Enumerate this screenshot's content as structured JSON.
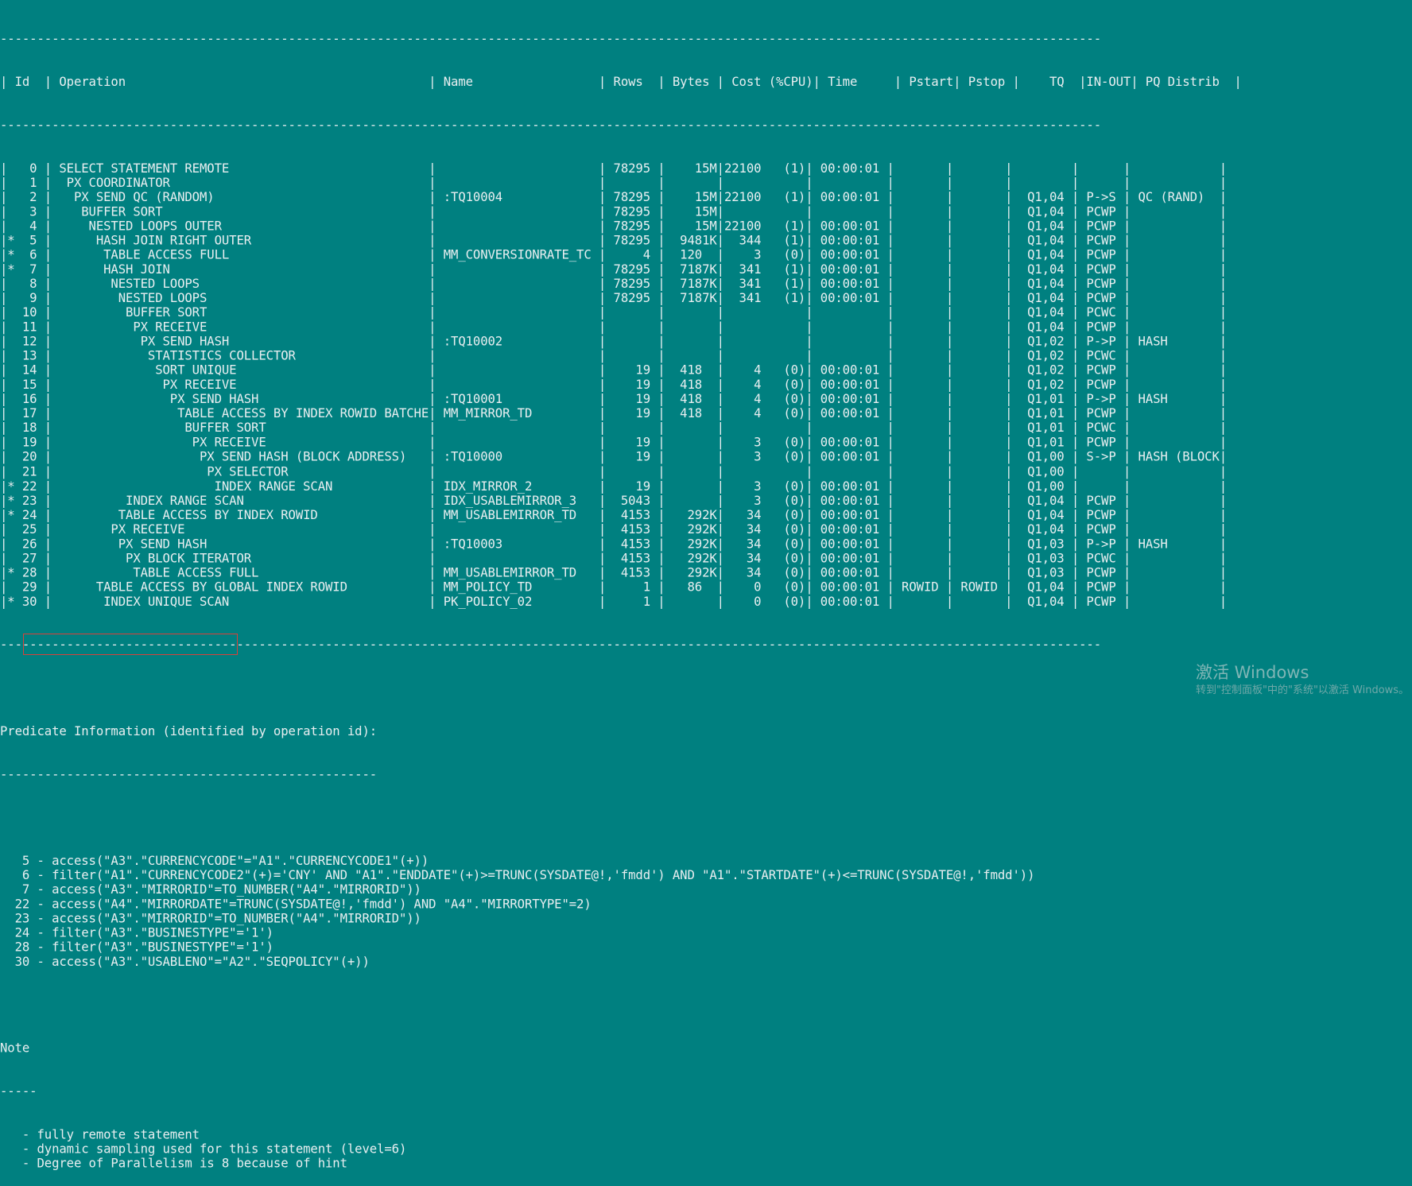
{
  "plan": {
    "dash_line": "-----------------------------------------------------------------------------------------------------------------------------------------------------",
    "columns": [
      "Id",
      "Operation",
      "Name",
      "Rows",
      "Bytes",
      "Cost (%CPU)",
      "Time",
      "Pstart",
      "Pstop",
      "TQ",
      "IN-OUT",
      "PQ Distrib"
    ],
    "rows": [
      {
        "star": "",
        "id": "0",
        "depth": 0,
        "op": "SELECT STATEMENT REMOTE",
        "name": "",
        "rows": "78295",
        "bytes": "15M",
        "cost": "22100",
        "cpu": "(1)",
        "time": "00:00:01",
        "pstart": "",
        "pstop": "",
        "tq": "",
        "inout": "",
        "pq": ""
      },
      {
        "star": "",
        "id": "1",
        "depth": 1,
        "op": "PX COORDINATOR",
        "name": "",
        "rows": "",
        "bytes": "",
        "cost": "",
        "cpu": "",
        "time": "",
        "pstart": "",
        "pstop": "",
        "tq": "",
        "inout": "",
        "pq": ""
      },
      {
        "star": "",
        "id": "2",
        "depth": 2,
        "op": "PX SEND QC (RANDOM)",
        "name": ":TQ10004",
        "rows": "78295",
        "bytes": "15M",
        "cost": "22100",
        "cpu": "(1)",
        "time": "00:00:01",
        "pstart": "",
        "pstop": "",
        "tq": "Q1,04",
        "inout": "P->S",
        "pq": "QC (RAND)"
      },
      {
        "star": "",
        "id": "3",
        "depth": 3,
        "op": "BUFFER SORT",
        "name": "",
        "rows": "78295",
        "bytes": "15M",
        "cost": "",
        "cpu": "",
        "time": "",
        "pstart": "",
        "pstop": "",
        "tq": "Q1,04",
        "inout": "PCWP",
        "pq": ""
      },
      {
        "star": "",
        "id": "4",
        "depth": 4,
        "op": "NESTED LOOPS OUTER",
        "name": "",
        "rows": "78295",
        "bytes": "15M",
        "cost": "22100",
        "cpu": "(1)",
        "time": "00:00:01",
        "pstart": "",
        "pstop": "",
        "tq": "Q1,04",
        "inout": "PCWP",
        "pq": ""
      },
      {
        "star": "*",
        "id": "5",
        "depth": 5,
        "op": "HASH JOIN RIGHT OUTER",
        "name": "",
        "rows": "78295",
        "bytes": "9481K",
        "cost": "344",
        "cpu": "(1)",
        "time": "00:00:01",
        "pstart": "",
        "pstop": "",
        "tq": "Q1,04",
        "inout": "PCWP",
        "pq": ""
      },
      {
        "star": "*",
        "id": "6",
        "depth": 6,
        "op": "TABLE ACCESS FULL",
        "name": "MM_CONVERSIONRATE_TC",
        "rows": "4",
        "bytes": "120",
        "cost": "3",
        "cpu": "(0)",
        "time": "00:00:01",
        "pstart": "",
        "pstop": "",
        "tq": "Q1,04",
        "inout": "PCWP",
        "pq": ""
      },
      {
        "star": "*",
        "id": "7",
        "depth": 6,
        "op": "HASH JOIN",
        "name": "",
        "rows": "78295",
        "bytes": "7187K",
        "cost": "341",
        "cpu": "(1)",
        "time": "00:00:01",
        "pstart": "",
        "pstop": "",
        "tq": "Q1,04",
        "inout": "PCWP",
        "pq": ""
      },
      {
        "star": "",
        "id": "8",
        "depth": 7,
        "op": "NESTED LOOPS",
        "name": "",
        "rows": "78295",
        "bytes": "7187K",
        "cost": "341",
        "cpu": "(1)",
        "time": "00:00:01",
        "pstart": "",
        "pstop": "",
        "tq": "Q1,04",
        "inout": "PCWP",
        "pq": ""
      },
      {
        "star": "",
        "id": "9",
        "depth": 8,
        "op": "NESTED LOOPS",
        "name": "",
        "rows": "78295",
        "bytes": "7187K",
        "cost": "341",
        "cpu": "(1)",
        "time": "00:00:01",
        "pstart": "",
        "pstop": "",
        "tq": "Q1,04",
        "inout": "PCWP",
        "pq": ""
      },
      {
        "star": "",
        "id": "10",
        "depth": 9,
        "op": "BUFFER SORT",
        "name": "",
        "rows": "",
        "bytes": "",
        "cost": "",
        "cpu": "",
        "time": "",
        "pstart": "",
        "pstop": "",
        "tq": "Q1,04",
        "inout": "PCWC",
        "pq": ""
      },
      {
        "star": "",
        "id": "11",
        "depth": 10,
        "op": "PX RECEIVE",
        "name": "",
        "rows": "",
        "bytes": "",
        "cost": "",
        "cpu": "",
        "time": "",
        "pstart": "",
        "pstop": "",
        "tq": "Q1,04",
        "inout": "PCWP",
        "pq": ""
      },
      {
        "star": "",
        "id": "12",
        "depth": 11,
        "op": "PX SEND HASH",
        "name": ":TQ10002",
        "rows": "",
        "bytes": "",
        "cost": "",
        "cpu": "",
        "time": "",
        "pstart": "",
        "pstop": "",
        "tq": "Q1,02",
        "inout": "P->P",
        "pq": "HASH"
      },
      {
        "star": "",
        "id": "13",
        "depth": 12,
        "op": "STATISTICS COLLECTOR",
        "name": "",
        "rows": "",
        "bytes": "",
        "cost": "",
        "cpu": "",
        "time": "",
        "pstart": "",
        "pstop": "",
        "tq": "Q1,02",
        "inout": "PCWC",
        "pq": ""
      },
      {
        "star": "",
        "id": "14",
        "depth": 13,
        "op": "SORT UNIQUE",
        "name": "",
        "rows": "19",
        "bytes": "418",
        "cost": "4",
        "cpu": "(0)",
        "time": "00:00:01",
        "pstart": "",
        "pstop": "",
        "tq": "Q1,02",
        "inout": "PCWP",
        "pq": ""
      },
      {
        "star": "",
        "id": "15",
        "depth": 14,
        "op": "PX RECEIVE",
        "name": "",
        "rows": "19",
        "bytes": "418",
        "cost": "4",
        "cpu": "(0)",
        "time": "00:00:01",
        "pstart": "",
        "pstop": "",
        "tq": "Q1,02",
        "inout": "PCWP",
        "pq": ""
      },
      {
        "star": "",
        "id": "16",
        "depth": 15,
        "op": "PX SEND HASH",
        "name": ":TQ10001",
        "rows": "19",
        "bytes": "418",
        "cost": "4",
        "cpu": "(0)",
        "time": "00:00:01",
        "pstart": "",
        "pstop": "",
        "tq": "Q1,01",
        "inout": "P->P",
        "pq": "HASH"
      },
      {
        "star": "",
        "id": "17",
        "depth": 16,
        "op": "TABLE ACCESS BY INDEX ROWID BATCHED",
        "name": "MM_MIRROR_TD",
        "rows": "19",
        "bytes": "418",
        "cost": "4",
        "cpu": "(0)",
        "time": "00:00:01",
        "pstart": "",
        "pstop": "",
        "tq": "Q1,01",
        "inout": "PCWP",
        "pq": ""
      },
      {
        "star": "",
        "id": "18",
        "depth": 17,
        "op": "BUFFER SORT",
        "name": "",
        "rows": "",
        "bytes": "",
        "cost": "",
        "cpu": "",
        "time": "",
        "pstart": "",
        "pstop": "",
        "tq": "Q1,01",
        "inout": "PCWC",
        "pq": ""
      },
      {
        "star": "",
        "id": "19",
        "depth": 18,
        "op": "PX RECEIVE",
        "name": "",
        "rows": "19",
        "bytes": "",
        "cost": "3",
        "cpu": "(0)",
        "time": "00:00:01",
        "pstart": "",
        "pstop": "",
        "tq": "Q1,01",
        "inout": "PCWP",
        "pq": ""
      },
      {
        "star": "",
        "id": "20",
        "depth": 19,
        "op": "PX SEND HASH (BLOCK ADDRESS)",
        "name": ":TQ10000",
        "rows": "19",
        "bytes": "",
        "cost": "3",
        "cpu": "(0)",
        "time": "00:00:01",
        "pstart": "",
        "pstop": "",
        "tq": "Q1,00",
        "inout": "S->P",
        "pq": "HASH (BLOCK"
      },
      {
        "star": "",
        "id": "21",
        "depth": 20,
        "op": "PX SELECTOR",
        "name": "",
        "rows": "",
        "bytes": "",
        "cost": "",
        "cpu": "",
        "time": "",
        "pstart": "",
        "pstop": "",
        "tq": "Q1,00",
        "inout": "",
        "pq": ""
      },
      {
        "star": "*",
        "id": "22",
        "depth": 21,
        "op": "INDEX RANGE SCAN",
        "name": "IDX_MIRROR_2",
        "rows": "19",
        "bytes": "",
        "cost": "3",
        "cpu": "(0)",
        "time": "00:00:01",
        "pstart": "",
        "pstop": "",
        "tq": "Q1,00",
        "inout": "",
        "pq": ""
      },
      {
        "star": "*",
        "id": "23",
        "depth": 9,
        "op": "INDEX RANGE SCAN",
        "name": "IDX_USABLEMIRROR_3",
        "rows": "5043",
        "bytes": "",
        "cost": "3",
        "cpu": "(0)",
        "time": "00:00:01",
        "pstart": "",
        "pstop": "",
        "tq": "Q1,04",
        "inout": "PCWP",
        "pq": ""
      },
      {
        "star": "*",
        "id": "24",
        "depth": 8,
        "op": "TABLE ACCESS BY INDEX ROWID",
        "name": "MM_USABLEMIRROR_TD",
        "rows": "4153",
        "bytes": "292K",
        "cost": "34",
        "cpu": "(0)",
        "time": "00:00:01",
        "pstart": "",
        "pstop": "",
        "tq": "Q1,04",
        "inout": "PCWP",
        "pq": ""
      },
      {
        "star": "",
        "id": "25",
        "depth": 7,
        "op": "PX RECEIVE",
        "name": "",
        "rows": "4153",
        "bytes": "292K",
        "cost": "34",
        "cpu": "(0)",
        "time": "00:00:01",
        "pstart": "",
        "pstop": "",
        "tq": "Q1,04",
        "inout": "PCWP",
        "pq": ""
      },
      {
        "star": "",
        "id": "26",
        "depth": 8,
        "op": "PX SEND HASH",
        "name": ":TQ10003",
        "rows": "4153",
        "bytes": "292K",
        "cost": "34",
        "cpu": "(0)",
        "time": "00:00:01",
        "pstart": "",
        "pstop": "",
        "tq": "Q1,03",
        "inout": "P->P",
        "pq": "HASH"
      },
      {
        "star": "",
        "id": "27",
        "depth": 9,
        "op": "PX BLOCK ITERATOR",
        "name": "",
        "rows": "4153",
        "bytes": "292K",
        "cost": "34",
        "cpu": "(0)",
        "time": "00:00:01",
        "pstart": "",
        "pstop": "",
        "tq": "Q1,03",
        "inout": "PCWC",
        "pq": ""
      },
      {
        "star": "*",
        "id": "28",
        "depth": 10,
        "op": "TABLE ACCESS FULL",
        "name": "MM_USABLEMIRROR_TD",
        "rows": "4153",
        "bytes": "292K",
        "cost": "34",
        "cpu": "(0)",
        "time": "00:00:01",
        "pstart": "",
        "pstop": "",
        "tq": "Q1,03",
        "inout": "PCWP",
        "pq": ""
      },
      {
        "star": "",
        "id": "29",
        "depth": 5,
        "op": "TABLE ACCESS BY GLOBAL INDEX ROWID",
        "name": "MM_POLICY_TD",
        "rows": "1",
        "bytes": "86",
        "cost": "0",
        "cpu": "(0)",
        "time": "00:00:01",
        "pstart": "ROWID",
        "pstop": "ROWID",
        "tq": "Q1,04",
        "inout": "PCWP",
        "pq": ""
      },
      {
        "star": "*",
        "id": "30",
        "depth": 6,
        "op": "INDEX UNIQUE SCAN",
        "name": "PK_POLICY_02",
        "rows": "1",
        "bytes": "",
        "cost": "0",
        "cpu": "(0)",
        "time": "00:00:01",
        "pstart": "",
        "pstop": "",
        "tq": "Q1,04",
        "inout": "PCWP",
        "pq": ""
      }
    ]
  },
  "predicate": {
    "title": "Predicate Information (identified by operation id):",
    "underline": "---------------------------------------------------",
    "lines": [
      "   5 - access(\"A3\".\"CURRENCYCODE\"=\"A1\".\"CURRENCYCODE1\"(+))",
      "   6 - filter(\"A1\".\"CURRENCYCODE2\"(+)='CNY' AND \"A1\".\"ENDDATE\"(+)>=TRUNC(SYSDATE@!,'fmdd') AND \"A1\".\"STARTDATE\"(+)<=TRUNC(SYSDATE@!,'fmdd'))",
      "   7 - access(\"A3\".\"MIRRORID\"=TO_NUMBER(\"A4\".\"MIRRORID\"))",
      "  22 - access(\"A4\".\"MIRRORDATE\"=TRUNC(SYSDATE@!,'fmdd') AND \"A4\".\"MIRRORTYPE\"=2)",
      "  23 - access(\"A3\".\"MIRRORID\"=TO_NUMBER(\"A4\".\"MIRRORID\"))",
      "  24 - filter(\"A3\".\"BUSINESTYPE\"='1')",
      "  28 - filter(\"A3\".\"BUSINESTYPE\"='1')",
      "  30 - access(\"A3\".\"USABLENO\"=\"A2\".\"SEQPOLICY\"(+))"
    ]
  },
  "note": {
    "title": "Note",
    "underline": "-----",
    "lines": [
      "   - fully remote statement",
      "   - dynamic sampling used for this statement (level=6)",
      "   - Degree of Parallelism is 8 because of hint"
    ]
  },
  "watermark": {
    "title": "激活 Windows",
    "subtitle": "转到\"控制面板\"中的\"系统\"以激活 Windows。"
  },
  "colors": {
    "background": "#008080",
    "text": "#e8eef0",
    "highlight_box": "#d9403a"
  }
}
